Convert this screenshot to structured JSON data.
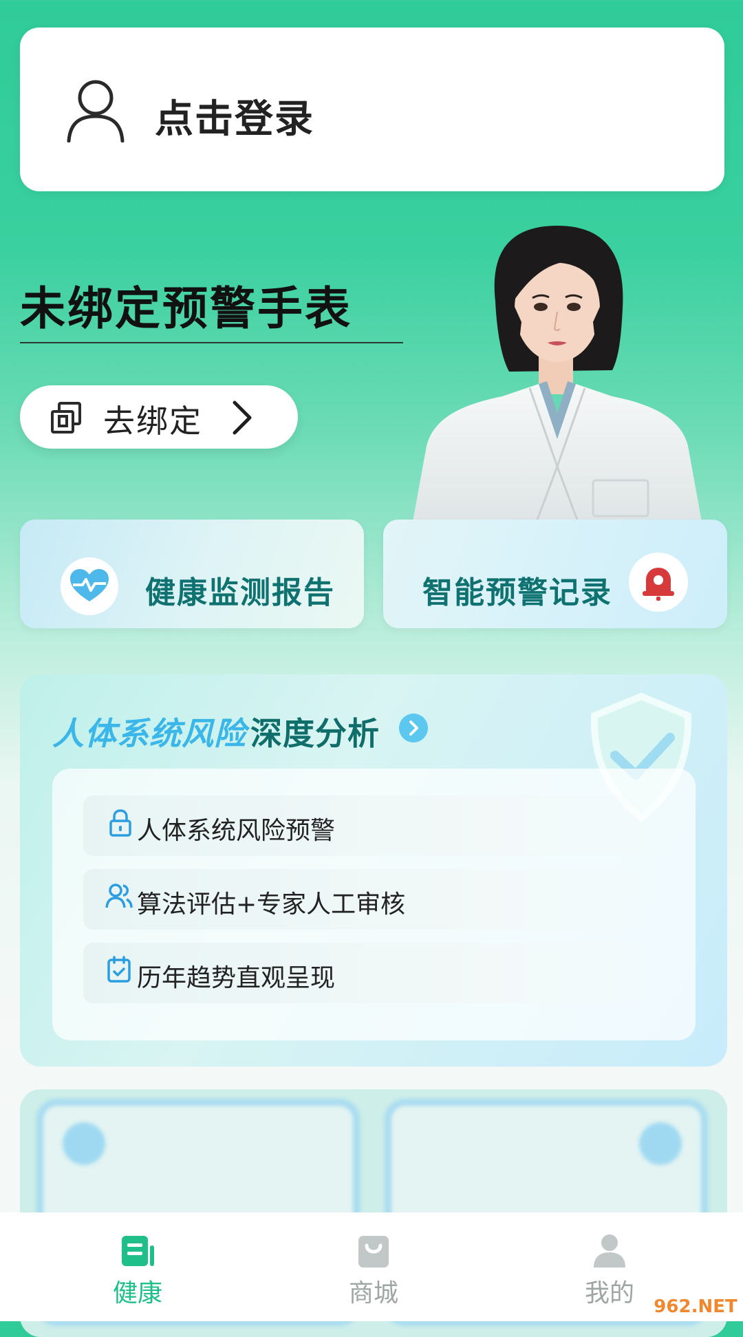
{
  "login": {
    "label": "点击登录"
  },
  "watch": {
    "title": "未绑定预警手表",
    "bind_label": "去绑定"
  },
  "features": [
    {
      "label": "健康监测报告"
    },
    {
      "label": "智能预警记录"
    }
  ],
  "risk": {
    "title_part1": "人体系统风险",
    "title_part2": "深度分析",
    "items": [
      {
        "icon": "lock-icon",
        "text": "人体系统风险预警"
      },
      {
        "icon": "users-icon",
        "text": "算法评估+专家人工审核"
      },
      {
        "icon": "calendar-check-icon",
        "text": "历年趋势直观呈现"
      }
    ]
  },
  "nav": [
    {
      "label": "健康",
      "icon": "health-news-icon",
      "active": true
    },
    {
      "label": "商城",
      "icon": "shopping-bag-icon",
      "active": false
    },
    {
      "label": "我的",
      "icon": "person-icon",
      "active": false
    }
  ],
  "watermark": "962.NET",
  "colors": {
    "accent": "#1fbf8a",
    "teal_text": "#0f7270",
    "risk_blue": "#3ab6e8",
    "bell_red": "#d63a3a"
  }
}
